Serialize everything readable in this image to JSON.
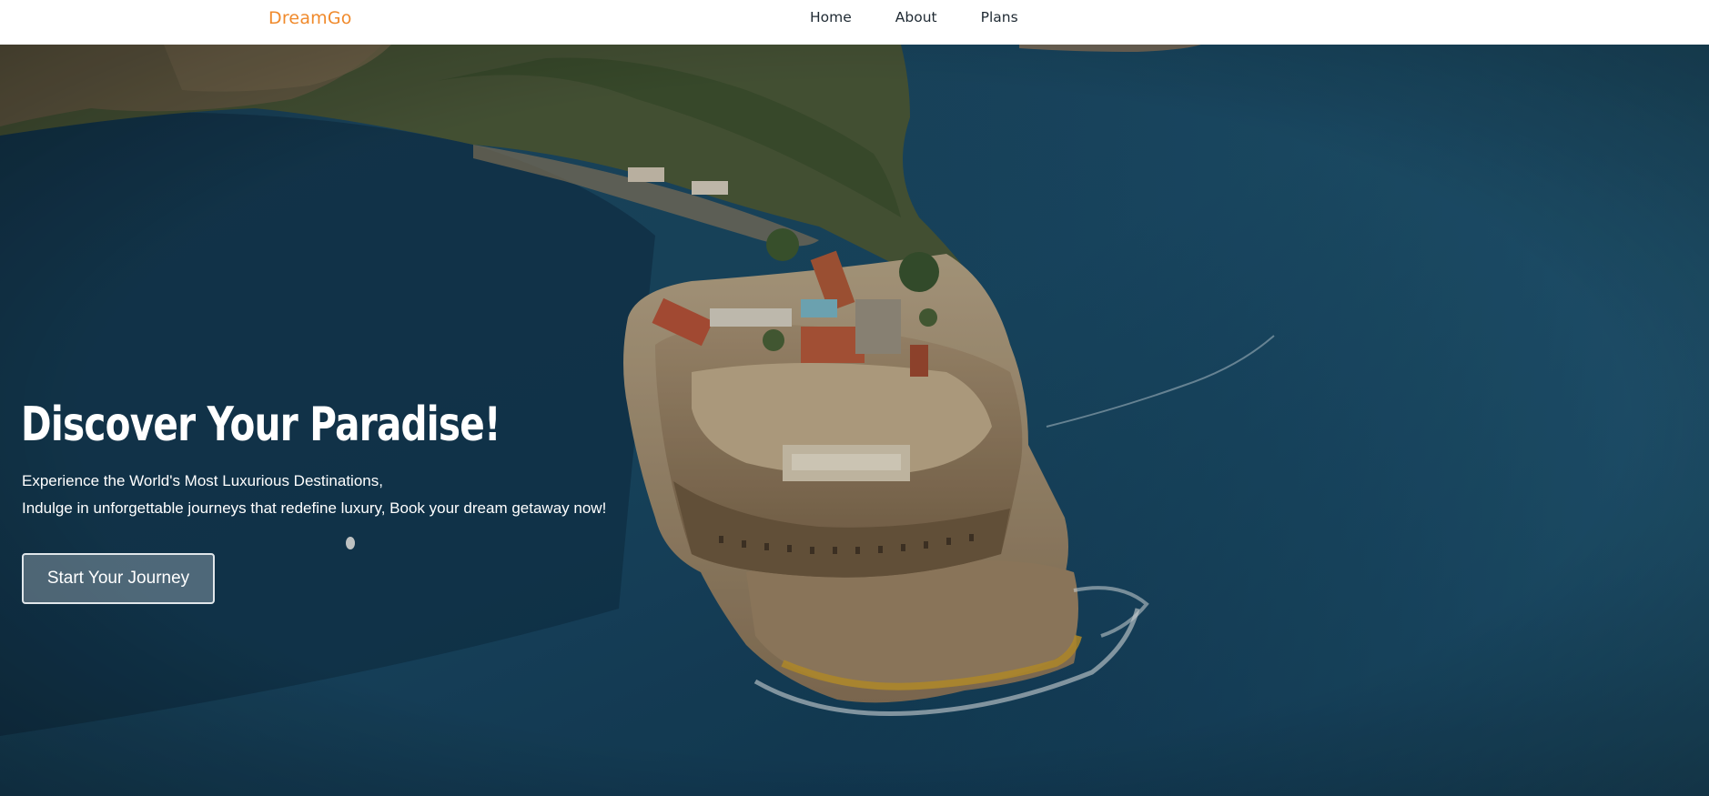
{
  "brand": {
    "name": "DreamGo",
    "color": "#f08a2c"
  },
  "nav": {
    "links": [
      "Home",
      "About",
      "Plans"
    ]
  },
  "hero": {
    "title": "Discover Your Paradise!",
    "subtitle_line1": "Experience the World's Most Luxurious Destinations,",
    "subtitle_line2": "Indulge in unforgettable journeys that redefine luxury, Book your dream getaway now!",
    "cta_label": "Start Your Journey",
    "background": "aerial-fortress-island-ocean-image"
  }
}
